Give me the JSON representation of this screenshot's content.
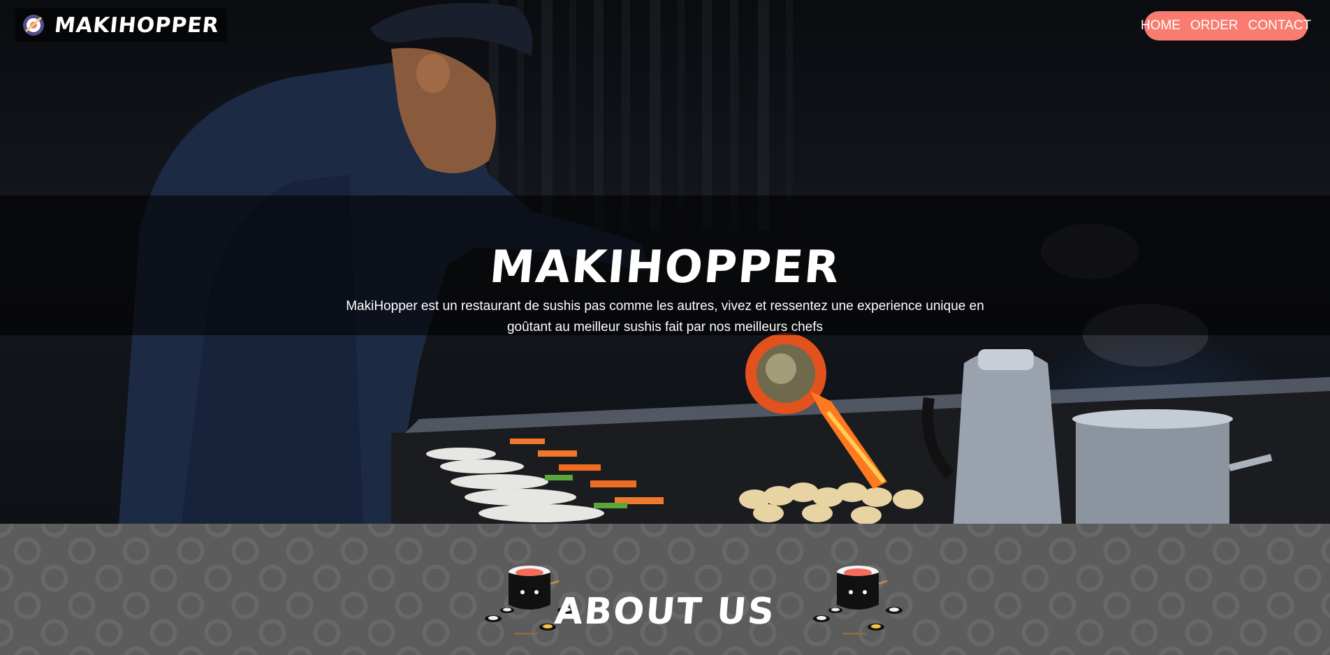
{
  "brand": {
    "name": "MAKIHOPPER",
    "logo_icon": "sushi-roll-icon"
  },
  "nav": {
    "accent_color": "#fa7b6f",
    "items": [
      {
        "label": "HOME"
      },
      {
        "label": "ORDER"
      },
      {
        "label": "CONTACT"
      }
    ]
  },
  "hero": {
    "title": "MAKIHOPPER",
    "description": "MakiHopper est un restaurant de sushis pas comme les autres, vivez et ressentez une experience unique en goûtant au meilleur sushis fait par nos meilleurs chefs",
    "image": "chef-torching-dishes-photo"
  },
  "about": {
    "title": "ABOUT US",
    "mascot_icon": "sushi-mascot-icon"
  }
}
